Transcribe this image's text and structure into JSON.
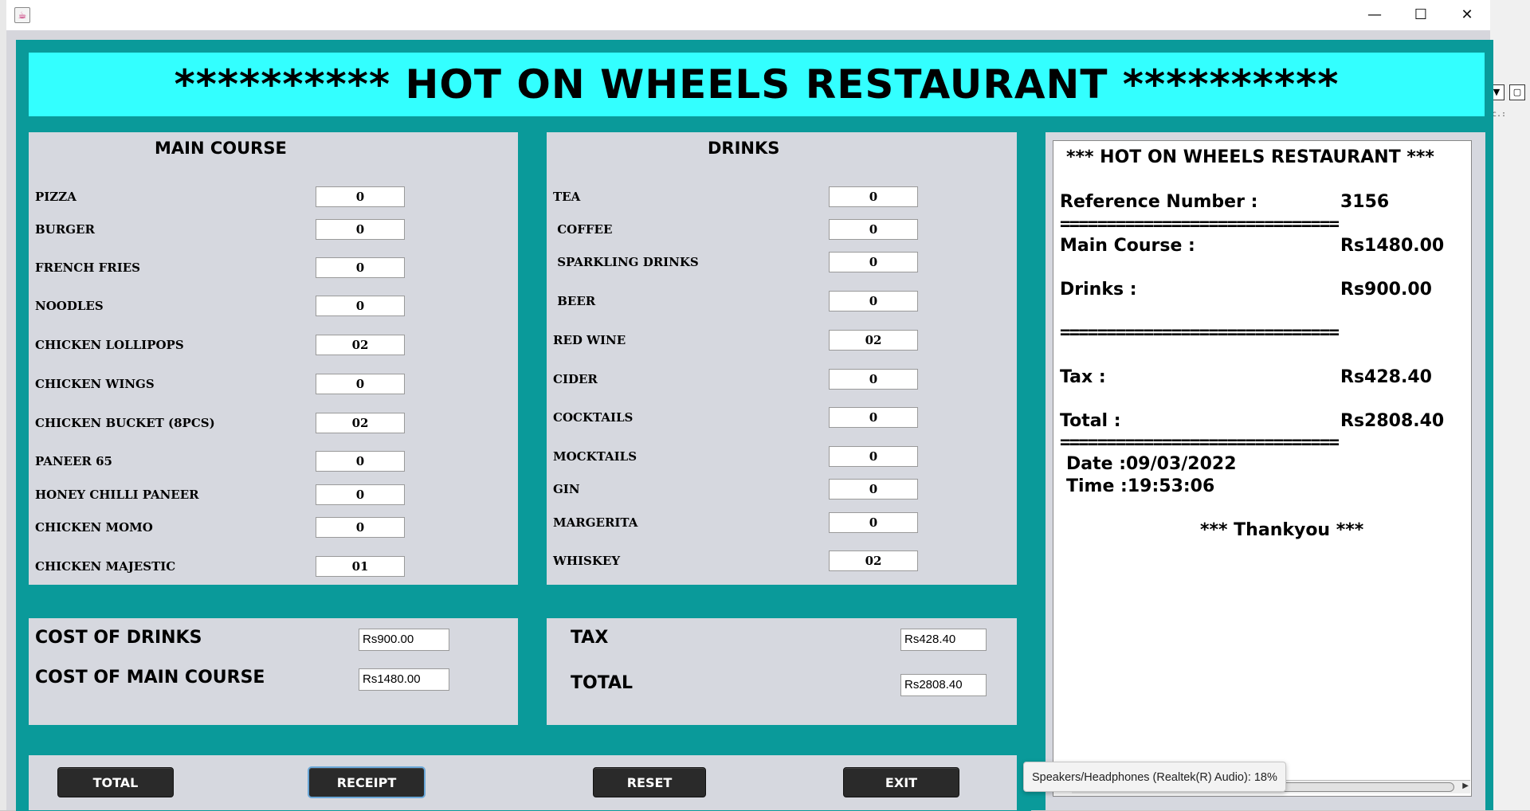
{
  "window": {
    "minimize_glyph": "—",
    "maximize_glyph": "☐",
    "close_glyph": "✕",
    "app_icon": "java-cup-icon"
  },
  "colors": {
    "teal": "#0a9a9a",
    "banner": "#33ffff",
    "panel": "#d6d8df",
    "button": "#2a2a2a"
  },
  "banner": {
    "title": "********** HOT ON WHEELS RESTAURANT **********"
  },
  "main_course": {
    "heading": "MAIN COURSE",
    "items": [
      {
        "label": "PIZZA",
        "qty": "0"
      },
      {
        "label": "BURGER",
        "qty": "0"
      },
      {
        "label": "FRENCH FRIES",
        "qty": "0"
      },
      {
        "label": "NOODLES",
        "qty": "0"
      },
      {
        "label": "CHICKEN LOLLIPOPS",
        "qty": "02"
      },
      {
        "label": "CHICKEN WINGS",
        "qty": "0"
      },
      {
        "label": "CHICKEN BUCKET (8PCS)",
        "qty": "02"
      },
      {
        "label": "PANEER 65",
        "qty": "0"
      },
      {
        "label": "HONEY CHILLI PANEER",
        "qty": "0"
      },
      {
        "label": "CHICKEN MOMO",
        "qty": "0"
      },
      {
        "label": "CHICKEN MAJESTIC",
        "qty": "01"
      }
    ]
  },
  "drinks": {
    "heading": "DRINKS",
    "items": [
      {
        "label": "TEA",
        "qty": "0"
      },
      {
        "label": " COFFEE",
        "qty": "0"
      },
      {
        "label": " SPARKLING DRINKS",
        "qty": "0"
      },
      {
        "label": " BEER",
        "qty": "0"
      },
      {
        "label": "RED WINE",
        "qty": "02"
      },
      {
        "label": "CIDER",
        "qty": "0"
      },
      {
        "label": "COCKTAILS",
        "qty": "0"
      },
      {
        "label": "MOCKTAILS",
        "qty": "0"
      },
      {
        "label": "GIN",
        "qty": "0"
      },
      {
        "label": "MARGERITA",
        "qty": "0"
      },
      {
        "label": "WHISKEY",
        "qty": "02"
      }
    ]
  },
  "costs": {
    "drinks_label": "COST OF DRINKS",
    "drinks_value": "Rs900.00",
    "main_label": "COST OF MAIN COURSE",
    "main_value": "Rs1480.00",
    "tax_label": "TAX",
    "tax_value": "Rs428.40",
    "total_label": "TOTAL",
    "total_value": "Rs2808.40"
  },
  "receipt": {
    "title": "*** HOT ON WHEELS RESTAURANT ***",
    "ref_label": "Reference Number :",
    "ref_value": "3156",
    "separator": "==============================",
    "main_label": "Main Course :",
    "main_value": "Rs1480.00",
    "drinks_label": "Drinks :",
    "drinks_value": "Rs900.00",
    "tax_label": "Tax :",
    "tax_value": "Rs428.40",
    "total_label": "Total :",
    "total_value": "Rs2808.40",
    "date": "Date :09/03/2022",
    "time": "Time :19:53:06",
    "thanks": "*** Thankyou ***"
  },
  "buttons": {
    "total": "TOTAL",
    "receipt": "RECEIPT",
    "reset": "RESET",
    "exit": "EXIT"
  },
  "tooltip": {
    "text": "Speakers/Headphones (Realtek(R) Audio): 18%"
  },
  "background_right": {
    "snippet": "c.:"
  }
}
